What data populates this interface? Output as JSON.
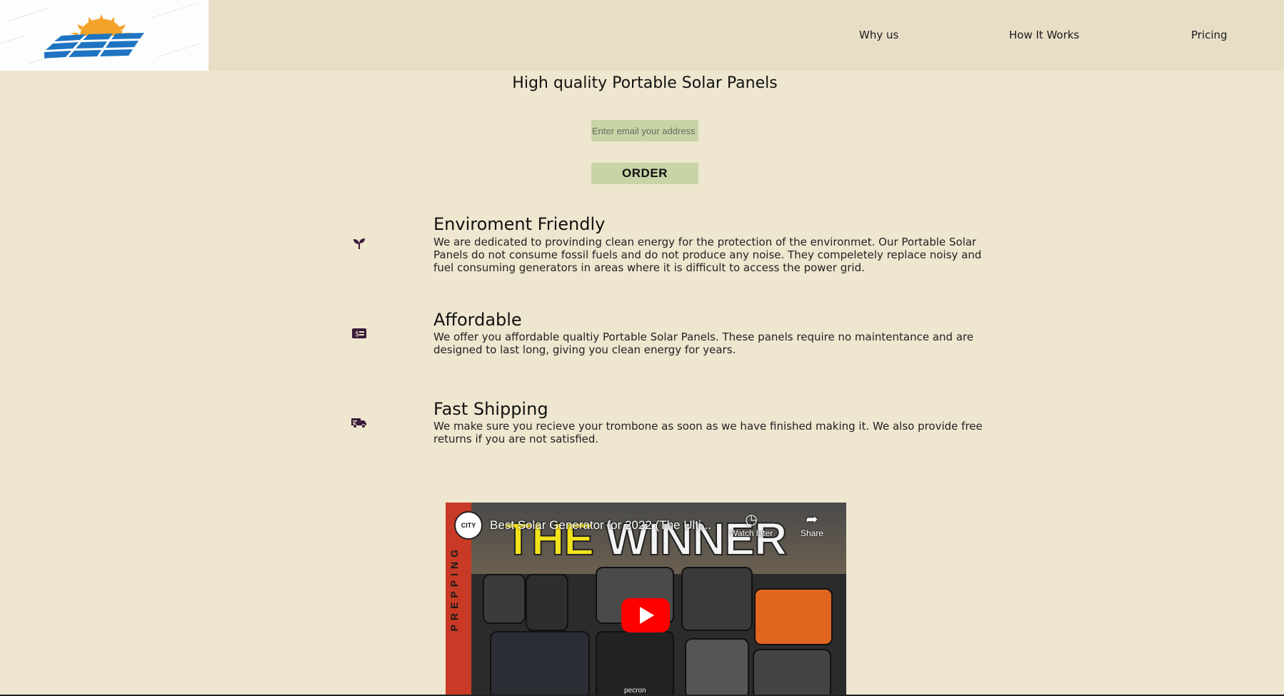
{
  "header": {
    "logo_name": "solar-panel-logo",
    "nav": [
      {
        "label": "Why us"
      },
      {
        "label": "How It Works"
      },
      {
        "label": "Pricing"
      }
    ]
  },
  "hero": {
    "title": "High quality Portable Solar Panels",
    "email_placeholder": "Enter email your address",
    "order_label": "ORDER"
  },
  "features": [
    {
      "icon": "seedling-icon",
      "title": "Enviroment Friendly",
      "description": "We are dedicated to provinding clean energy for the protection of the environmet. Our Portable Solar Panels do not consume fossil fuels and do not produce any noise. They compeletely replace noisy and fuel consuming generators in areas where it is difficult to access the power grid."
    },
    {
      "icon": "money-bill-icon",
      "title": "Affordable",
      "description": "We offer you affordable qualtiy Portable Solar Panels. These panels require no maintentance and are designed to last long, giving you clean energy for years."
    },
    {
      "icon": "shipping-truck-icon",
      "title": "Fast Shipping",
      "description": "We make sure you recieve your trombone as soon as we have finished making it. We also provide free returns if you are not satisfied."
    }
  ],
  "video": {
    "title": "Best Solar Generator for 2022 (The Ulti...",
    "thumbnail_text_the": "THE",
    "thumbnail_text_winner": "WINNER",
    "side_text": "PREPPING",
    "channel_badge": "CITY",
    "watch_later_label": "Watch later",
    "share_label": "Share",
    "brand_label": "pecron"
  },
  "colors": {
    "page_bg": "#eee6cf",
    "header_bg": "#e8dec6",
    "input_bg": "#c8d4a6",
    "icon_color": "#3a1a3a",
    "play_red": "#ff0000"
  }
}
